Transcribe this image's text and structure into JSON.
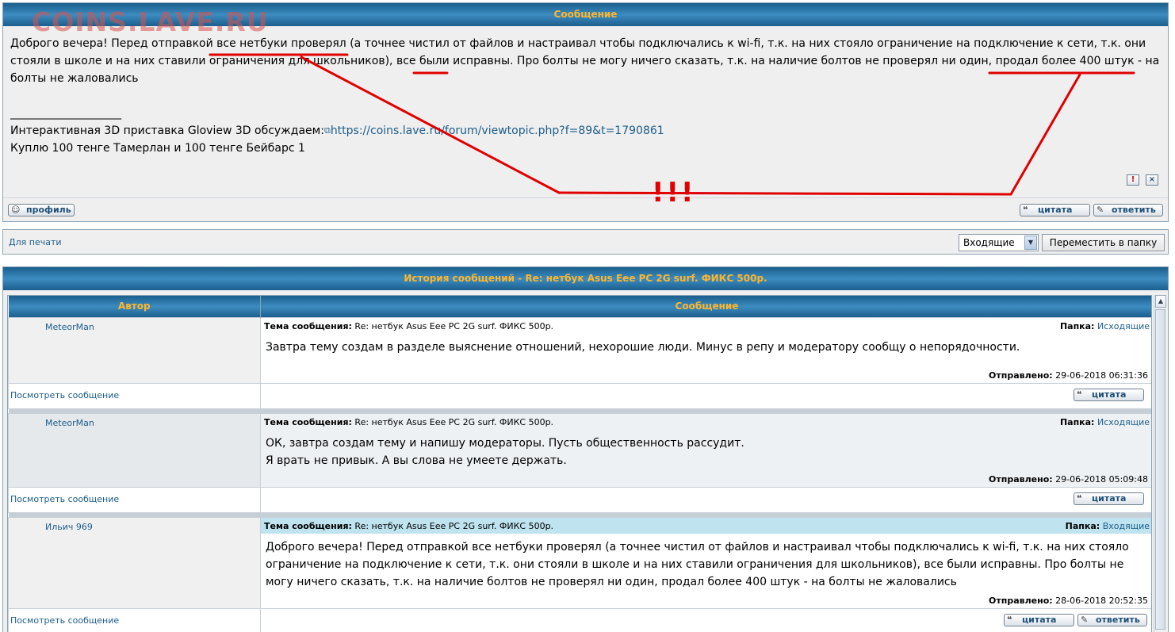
{
  "watermark": "COINS.LAVE.RU",
  "message": {
    "header": "Сообщение",
    "body": "Доброго вечера! Перед отправкой все нетбуки проверял (а точнее чистил от файлов и настраивал чтобы подключались к wi-fi, т.к. на них стояло ограничение на подключение к сети, т.к. они стояли в школе и на них ставили ограничения для школьников), все были исправны. Про болты не могу ничего сказать, т.к. на наличие болтов не проверял ни один, продал более 400 штук - на болты не жаловались",
    "signature_rule": "____________________",
    "signature_prefix": "Интерактивная 3D приставка Gloview 3D обсуждаем:",
    "signature_link": "https://coins.lave.ru/forum/viewtopic.php?f=89&t=1790861",
    "signature_line2": "Куплю 100 тенге Тамерлан и 100 тенге Бейбарс 1",
    "report_glyph": "!",
    "close_glyph": "×",
    "profile_label": "профиль",
    "quote_label": "цитата",
    "reply_label": "ответить",
    "annotation_text": "!!!"
  },
  "bar": {
    "print_label": "Для печати",
    "folder_selected": "Входящие",
    "move_label": "Переместить в папку"
  },
  "history": {
    "header": "История сообщений - Re: нетбук Asus Eee PC 2G surf. ФИКС 500р.",
    "col_author": "Автор",
    "col_message": "Сообщение",
    "subject_label": "Тема сообщения:",
    "folder_label": "Папка:",
    "sent_label": "Отправлено:",
    "view_label": "Посмотреть сообщение",
    "quote_label": "цитата",
    "reply_label": "ответить",
    "posts": [
      {
        "author": "MeteorMan",
        "subject": "Re: нетбук Asus Eee PC 2G surf. ФИКС 500р.",
        "folder": "Исходящие",
        "lines": [
          "Завтра тему создам в разделе выяснение отношений, нехорошие люди. Минус в репу и модератору сообщу о непорядочности."
        ],
        "sent": "29-06-2018 06:31:36"
      },
      {
        "author": "MeteorMan",
        "subject": "Re: нетбук Asus Eee PC 2G surf. ФИКС 500р.",
        "folder": "Исходящие",
        "lines": [
          "ОК, завтра создам тему и напишу модераторы. Пусть общественность рассудит.",
          "Я врать не привык. А вы слова не умеете держать."
        ],
        "sent": "29-06-2018 05:09:48"
      },
      {
        "author": "Ильич 969",
        "subject": "Re: нетбук Asus Eee PC 2G surf. ФИКС 500р.",
        "folder": "Входящие",
        "lines": [
          "Доброго вечера! Перед отправкой все нетбуки проверял (а точнее чистил от файлов и настраивал чтобы подключались к wi-fi, т.к. на них стояло",
          "ограничение на подключение к сети, т.к. они стояли в школе и на них ставили ограничения для школьников), все были исправны. Про болты не",
          "могу ничего сказать, т.к. на наличие болтов не проверял ни один, продал более 400 штук - на болты не жаловались"
        ],
        "sent": "28-06-2018 20:52:35"
      }
    ]
  },
  "colors": {
    "header_text": "#ffb62a",
    "link": "#1d5d8a",
    "annotation": "#e00000",
    "highlight_row": "#bfe3ef"
  }
}
